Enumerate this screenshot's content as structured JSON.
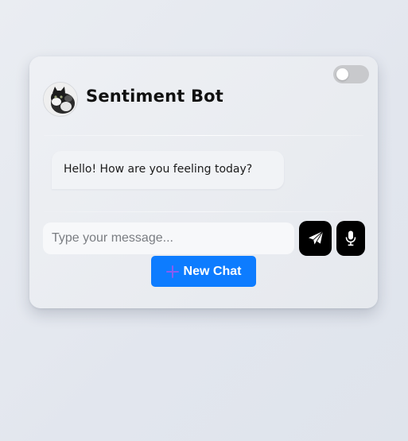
{
  "header": {
    "bot_name": "Sentiment Bot",
    "avatar_icon": "cat-avatar-icon",
    "theme_toggle": {
      "on": false
    }
  },
  "messages": [
    {
      "sender": "bot",
      "text": "Hello! How are you feeling today?"
    }
  ],
  "composer": {
    "placeholder": "Type your message...",
    "value": "",
    "send_icon": "paper-plane-icon",
    "mic_icon": "microphone-icon"
  },
  "actions": {
    "new_chat_label": "New Chat",
    "new_chat_icon": "plus-icon"
  },
  "colors": {
    "accent": "#0d7cff",
    "plus": "#8a5cf0",
    "icon_button": "#000000",
    "toggle_off": "#c8c9cc"
  }
}
